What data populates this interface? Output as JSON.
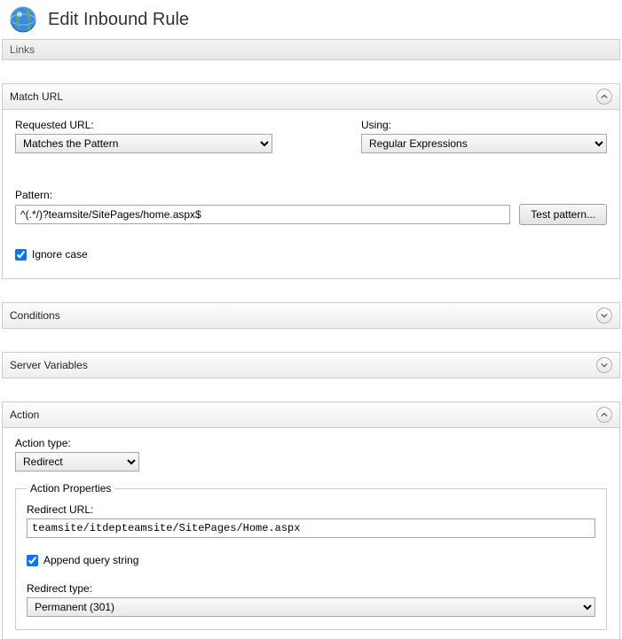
{
  "header": {
    "title": "Edit Inbound Rule",
    "links_label": "Links"
  },
  "matchUrl": {
    "section_title": "Match URL",
    "requested_url_label": "Requested URL:",
    "requested_url_value": "Matches the Pattern",
    "using_label": "Using:",
    "using_value": "Regular Expressions",
    "pattern_label": "Pattern:",
    "pattern_value": "^(.*/)?teamsite/SitePages/home.aspx$",
    "test_button": "Test pattern...",
    "ignore_case_label": "Ignore case",
    "ignore_case_checked": true
  },
  "conditions": {
    "section_title": "Conditions"
  },
  "serverVariables": {
    "section_title": "Server Variables"
  },
  "action": {
    "section_title": "Action",
    "action_type_label": "Action type:",
    "action_type_value": "Redirect",
    "properties_legend": "Action Properties",
    "redirect_url_label": "Redirect URL:",
    "redirect_url_value": "teamsite/itdepteamsite/SitePages/Home.aspx",
    "append_query_label": "Append query string",
    "append_query_checked": true,
    "redirect_type_label": "Redirect type:",
    "redirect_type_value": "Permanent (301)"
  }
}
